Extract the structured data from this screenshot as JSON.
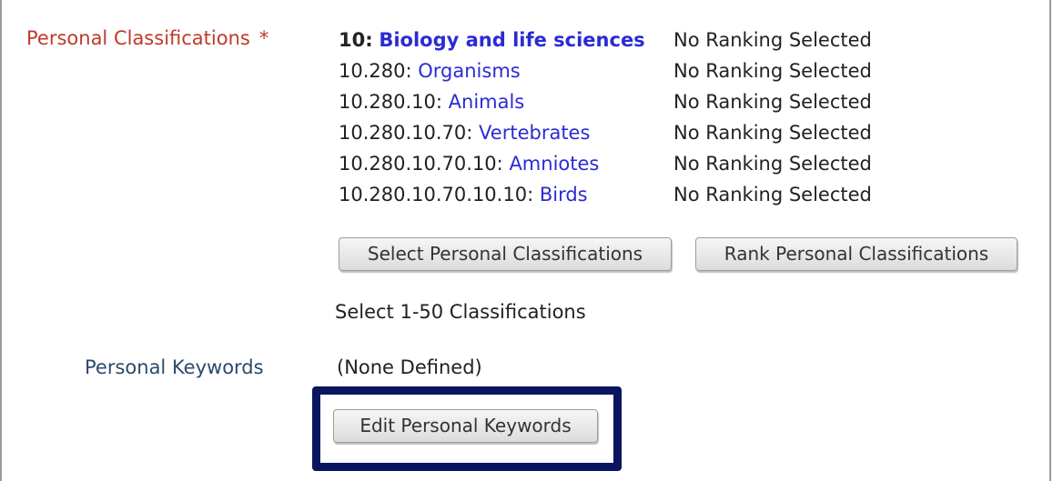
{
  "classifications": {
    "label": "Personal Classifications",
    "required_marker": "*",
    "rows": [
      {
        "code": "10:",
        "term": "Biology and life sciences",
        "ranking": "No Ranking Selected"
      },
      {
        "code": "10.280:",
        "term": "Organisms",
        "ranking": "No Ranking Selected"
      },
      {
        "code": "10.280.10:",
        "term": "Animals",
        "ranking": "No Ranking Selected"
      },
      {
        "code": "10.280.10.70:",
        "term": "Vertebrates",
        "ranking": "No Ranking Selected"
      },
      {
        "code": "10.280.10.70.10:",
        "term": "Amniotes",
        "ranking": "No Ranking Selected"
      },
      {
        "code": "10.280.10.70.10.10:",
        "term": "Birds",
        "ranking": "No Ranking Selected"
      }
    ],
    "select_button_label": "Select Personal Classifications",
    "rank_button_label": "Rank Personal Classifications",
    "hint": "Select 1-50 Classifications"
  },
  "keywords": {
    "label": "Personal Keywords",
    "value": "(None Defined)",
    "edit_button_label": "Edit Personal Keywords"
  },
  "colors": {
    "required_label": "#c0392b",
    "link_term": "#2b2bd4",
    "keywords_label": "#2b4a6b",
    "highlight_border": "#0a1560"
  }
}
